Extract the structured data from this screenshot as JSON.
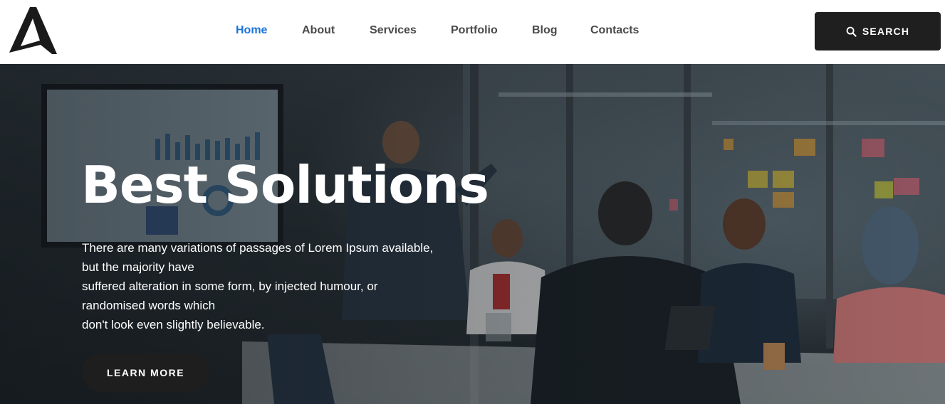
{
  "header": {
    "logo_icon": "triangle-logo-icon",
    "nav": [
      {
        "label": "Home",
        "active": true
      },
      {
        "label": "About",
        "active": false
      },
      {
        "label": "Services",
        "active": false
      },
      {
        "label": "Portfolio",
        "active": false
      },
      {
        "label": "Blog",
        "active": false
      },
      {
        "label": "Contacts",
        "active": false
      }
    ],
    "search": {
      "label": "SEARCH",
      "icon": "search-icon"
    }
  },
  "hero": {
    "title": "Best Solutions",
    "lines": [
      "There are many variations of passages of Lorem Ipsum available,",
      "but the majority have",
      "suffered alteration in some form, by injected humour, or",
      "randomised words which",
      "don't look even slightly believable."
    ],
    "cta_label": "LEARN MORE"
  },
  "colors": {
    "accent": "#1a73d9",
    "nav_text": "#4a4a4a",
    "button_dark": "#1f1f1f",
    "hero_text": "#ffffff"
  }
}
